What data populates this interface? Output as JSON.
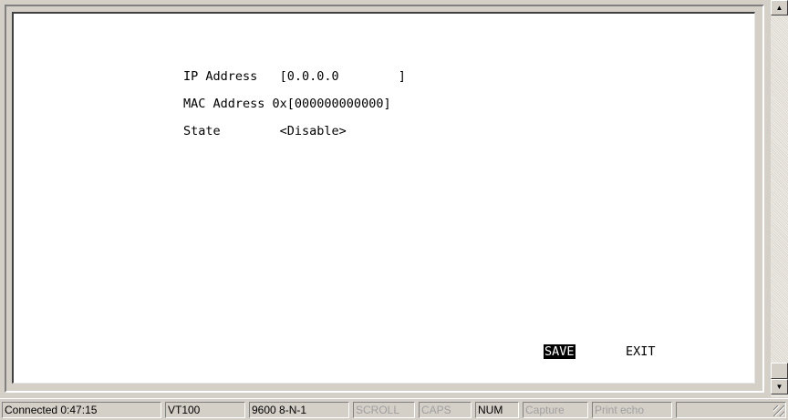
{
  "terminal": {
    "lines": {
      "ip_row": "IP Address   [0.0.0.0        ]",
      "mac_row": "MAC Address 0x[000000000000]",
      "state_row": "State        <Disable>"
    },
    "actions": {
      "save_label": "SAVE",
      "exit_label": "EXIT"
    }
  },
  "scrollbar": {
    "up_glyph": "▲",
    "down_glyph": "▼"
  },
  "status_bar": {
    "connected": "Connected 0:47:15",
    "emulation": "VT100",
    "port_settings": "9600 8-N-1",
    "scroll": "SCROLL",
    "caps": "CAPS",
    "num": "NUM",
    "capture": "Capture",
    "print_echo": "Print echo"
  }
}
